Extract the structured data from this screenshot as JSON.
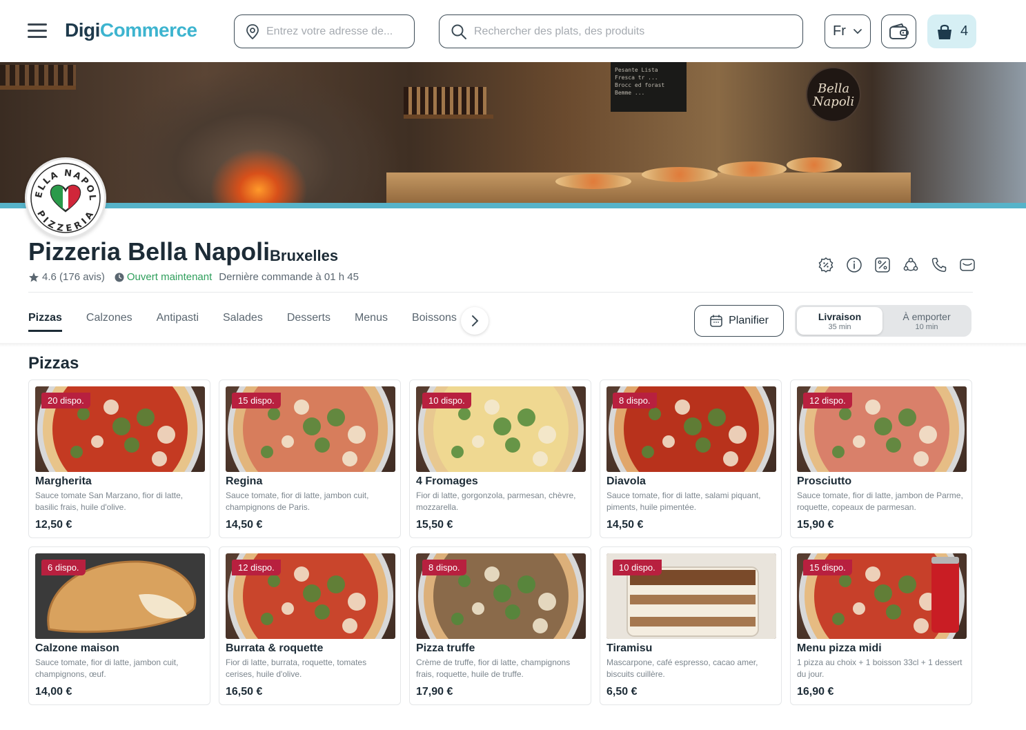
{
  "header": {
    "logo_part1": "Digi",
    "logo_part2": "Commerce",
    "address_placeholder": "Entrez votre adresse de...",
    "search_placeholder": "Rechercher des plats, des produits",
    "language": "Fr",
    "cart_count": "4"
  },
  "banner": {
    "sign_text": "Bella Napoli",
    "board_lines": [
      "Pesante Lista",
      "Fresca tr ...",
      "Brocc ed forast",
      "Bemme ..."
    ]
  },
  "store": {
    "name": "Pizzeria Bella Napoli",
    "city": "Bruxelles",
    "rating": "4.6 (176 avis)",
    "status": "Ouvert maintenant",
    "last_order": "Dernière commande à 01 h 45",
    "logo_top": "BELLA NAPOLI",
    "logo_bottom": "PIZZERIA"
  },
  "tabs": [
    "Pizzas",
    "Calzones",
    "Antipasti",
    "Salades",
    "Desserts",
    "Menus",
    "Boissons"
  ],
  "active_tab": "Pizzas",
  "schedule_label": "Planifier",
  "modes": {
    "delivery": {
      "label": "Livraison",
      "time": "35 min"
    },
    "takeaway": {
      "label": "À emporter",
      "time": "10 min"
    }
  },
  "section_title": "Pizzas",
  "products": [
    {
      "badge": "20 dispo.",
      "name": "Margherita",
      "desc": "Sauce tomate San Marzano, fior di latte, basilic frais, huile d'olive.",
      "price": "12,50 €",
      "crust": "#e8c48a",
      "top": "#c43a22",
      "kind": "pizza"
    },
    {
      "badge": "15 dispo.",
      "name": "Regina",
      "desc": "Sauce tomate, fior di latte, jambon cuit, champignons de Paris.",
      "price": "14,50 €",
      "crust": "#e2b57c",
      "top": "#d77d5c",
      "kind": "pizza"
    },
    {
      "badge": "10 dispo.",
      "name": "4 Fromages",
      "desc": "Fior di latte, gorgonzola, parmesan, chèvre, mozzarella.",
      "price": "15,50 €",
      "crust": "#e8c890",
      "top": "#efd891",
      "kind": "pizza"
    },
    {
      "badge": "8 dispo.",
      "name": "Diavola",
      "desc": "Sauce tomate, fior di latte, salami piquant, piments, huile pimentée.",
      "price": "14,50 €",
      "crust": "#e0a66b",
      "top": "#b8321c",
      "kind": "pizza"
    },
    {
      "badge": "12 dispo.",
      "name": "Prosciutto",
      "desc": "Sauce tomate, fior di latte, jambon de Parme, roquette, copeaux de parmesan.",
      "price": "15,90 €",
      "crust": "#e6bd85",
      "top": "#d9806a",
      "kind": "pizza"
    },
    {
      "badge": "6 dispo.",
      "name": "Calzone maison",
      "desc": "Sauce tomate, fior di latte, jambon cuit, champignons, œuf.",
      "price": "14,00 €",
      "crust": "#d9a25e",
      "top": "#e8c07a",
      "kind": "calzone"
    },
    {
      "badge": "12 dispo.",
      "name": "Burrata & roquette",
      "desc": "Fior di latte, burrata, roquette, tomates cerises, huile d'olive.",
      "price": "16,50 €",
      "crust": "#e4b77d",
      "top": "#c9452c",
      "kind": "pizza"
    },
    {
      "badge": "8 dispo.",
      "name": "Pizza truffe",
      "desc": "Crème de truffe, fior di latte, champignons frais, roquette, huile de truffe.",
      "price": "17,90 €",
      "crust": "#dcb07a",
      "top": "#8a6a4a",
      "kind": "pizza"
    },
    {
      "badge": "10 dispo.",
      "name": "Tiramisu",
      "desc": "Mascarpone, café espresso, cacao amer, biscuits cuillère.",
      "price": "6,50 €",
      "crust": "#f2ead8",
      "top": "#7a4a2a",
      "kind": "dessert"
    },
    {
      "badge": "15 dispo.",
      "name": "Menu pizza midi",
      "desc": "1 pizza au choix + 1 boisson 33cl + 1 dessert du jour.",
      "price": "16,90 €",
      "crust": "#e6bb82",
      "top": "#c7402a",
      "kind": "menu"
    }
  ],
  "colors": {
    "brand_dark": "#1e3a4c",
    "brand_accent": "#3db4cf",
    "badge": "#b8203f",
    "open": "#2e9e5b"
  },
  "icons": {
    "action_icons": [
      "discount-icon",
      "info-icon",
      "promo-icon",
      "share-icon",
      "phone-icon",
      "message-icon"
    ]
  }
}
